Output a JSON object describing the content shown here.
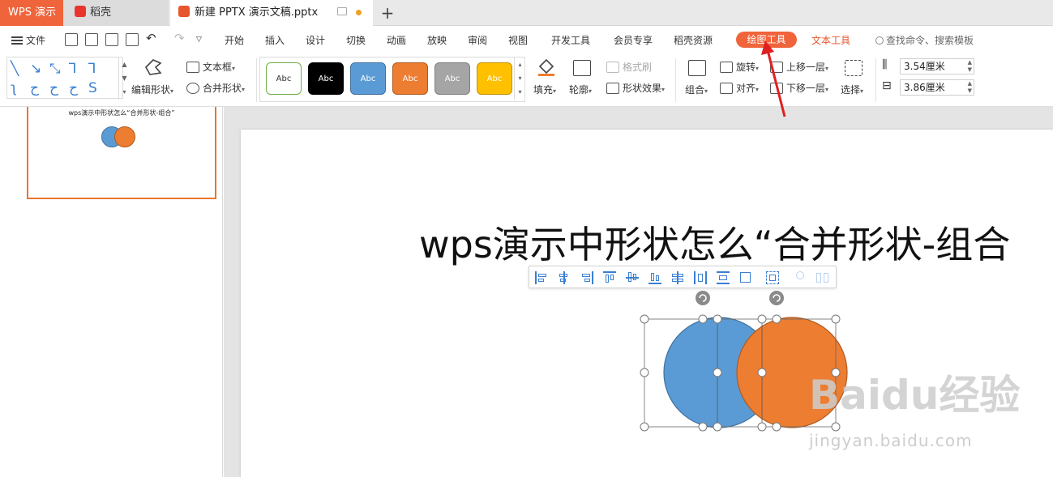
{
  "tabs": {
    "app": "WPS 演示",
    "daoke": "稻壳",
    "document": "新建 PPTX 演示文稿.pptx",
    "add": "+"
  },
  "menu": {
    "file": "文件",
    "items": [
      "开始",
      "插入",
      "设计",
      "切换",
      "动画",
      "放映",
      "审阅",
      "视图",
      "开发工具",
      "会员专享",
      "稻壳资源"
    ],
    "active": "绘图工具",
    "text_tool": "文本工具",
    "search": "查找命令、搜索模板"
  },
  "ribbon": {
    "edit_shape": "编辑形状",
    "text_box": "文本框",
    "merge_shape": "合并形状",
    "style_swatches": [
      {
        "label": "Abc",
        "bg": "#ffffff",
        "fg": "#333333",
        "border": "#70ad47"
      },
      {
        "label": "Abc",
        "bg": "#000000",
        "fg": "#ffffff",
        "border": "#000000"
      },
      {
        "label": "Abc",
        "bg": "#5b9bd5",
        "fg": "#ffffff",
        "border": "#41719c"
      },
      {
        "label": "Abc",
        "bg": "#ed7d31",
        "fg": "#ffffff",
        "border": "#ae5a21"
      },
      {
        "label": "Abc",
        "bg": "#a5a5a5",
        "fg": "#ffffff",
        "border": "#7f7f7f"
      },
      {
        "label": "Abc",
        "bg": "#ffc000",
        "fg": "#ffffff",
        "border": "#bf9000"
      }
    ],
    "fill": "填充",
    "outline": "轮廓",
    "format_brush": "格式刷",
    "shape_effect": "形状效果",
    "group": "组合",
    "rotate": "旋转",
    "align": "对齐",
    "bring_forward": "上移一层",
    "send_backward": "下移一层",
    "select": "选择",
    "height": "3.54厘米",
    "width": "3.86厘米"
  },
  "thumbnail": {
    "title": "wps演示中形状怎么“合并形状-组合”"
  },
  "slide": {
    "title": "wps演示中形状怎么“合并形状-组合"
  },
  "colors": {
    "accent": "#f0643c",
    "circle_blue": "#5b9bd5",
    "circle_orange": "#ed7d31",
    "arrow": "#e02020"
  },
  "watermark": {
    "brand": "Baidu经验",
    "url": "jingyan.baidu.com"
  }
}
